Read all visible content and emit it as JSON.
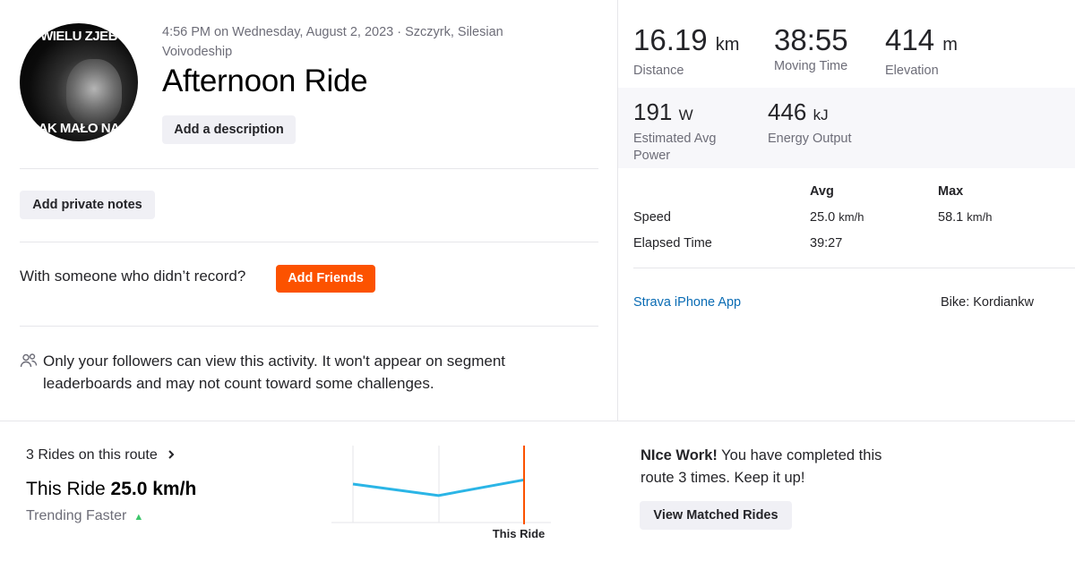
{
  "activity": {
    "avatar_caption_top": "WIELU ZJEB",
    "avatar_caption_bottom": "AK MAŁO NA",
    "meta": "4:56 PM on Wednesday, August 2, 2023 · Szczyrk, Silesian Voivodeship",
    "title": "Afternoon Ride",
    "add_description": "Add a description",
    "add_private_notes": "Add private notes",
    "with_someone": "With someone who didn’t record?",
    "add_friends": "Add Friends",
    "privacy_icon": "followers-icon",
    "privacy_text": "Only your followers can view this activity. It won't appear on segment leaderboards and may not count toward some challenges."
  },
  "stats": {
    "distance": {
      "value": "16.19",
      "unit": "km",
      "label": "Distance"
    },
    "moving_time": {
      "value": "38:55",
      "label": "Moving Time"
    },
    "elevation": {
      "value": "414",
      "unit": "m",
      "label": "Elevation"
    },
    "power": {
      "value": "191",
      "unit": "W",
      "label": "Estimated Avg Power"
    },
    "energy": {
      "value": "446",
      "unit": "kJ",
      "label": "Energy Output"
    }
  },
  "table": {
    "col_avg": "Avg",
    "col_max": "Max",
    "rows": [
      {
        "label": "Speed",
        "avg": "25.0",
        "avg_unit": "km/h",
        "max": "58.1",
        "max_unit": "km/h"
      },
      {
        "label": "Elapsed Time",
        "avg": "39:27",
        "avg_unit": "",
        "max": "",
        "max_unit": ""
      }
    ]
  },
  "device": {
    "app": "Strava iPhone App",
    "bike": "Bike: Kordiankw"
  },
  "route": {
    "rides_on_route": "3 Rides on this route",
    "this_ride_prefix": "This Ride",
    "this_ride_speed": "25.0 km/h",
    "trending": "Trending Faster",
    "chart_marker_label": "This Ride",
    "nice_bold": "NIce Work!",
    "nice_rest": " You have completed this route 3 times. Keep it up!",
    "view_matched": "View Matched Rides"
  },
  "colors": {
    "accent": "#fc5200",
    "link": "#0a6cb4",
    "chart_line": "#2bb5e6",
    "trend_up": "#3dc66b"
  },
  "chart_data": {
    "type": "line",
    "x": [
      1,
      2,
      3
    ],
    "values": [
      25.0,
      23.9,
      25.4
    ],
    "marker_label": "This Ride"
  }
}
